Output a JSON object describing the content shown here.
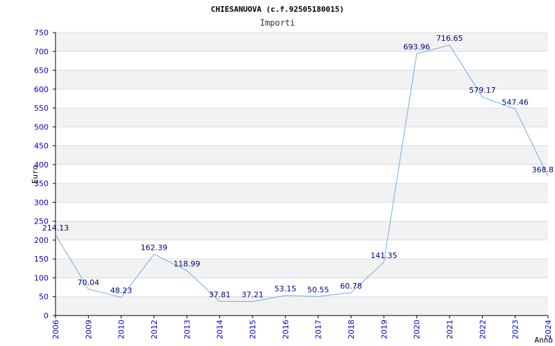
{
  "chart_data": {
    "type": "line",
    "title": "CHIESANUOVA (c.f.92505180015)",
    "subtitle": "Importi",
    "xlabel": "Anno",
    "ylabel": "Euro",
    "ylim": [
      0,
      750
    ],
    "ytick_step": 50,
    "categories": [
      "2006",
      "2009",
      "2010",
      "2012",
      "2013",
      "2014",
      "2015",
      "2016",
      "2017",
      "2018",
      "2019",
      "2020",
      "2021",
      "2022",
      "2023",
      "2024"
    ],
    "values": [
      214.13,
      70.04,
      48.23,
      162.39,
      118.99,
      37.81,
      37.21,
      53.15,
      50.55,
      60.78,
      141.35,
      693.96,
      716.65,
      579.17,
      547.46,
      368.8
    ],
    "labels": [
      "214.13",
      "70.04",
      "48.23",
      "162.39",
      "118.99",
      "37.81",
      "37.21",
      "53.15",
      "50.55",
      "60.78",
      "141.35",
      "693.96",
      "716.65",
      "579.17",
      "547.46",
      "368.8"
    ],
    "grid": true,
    "legend": "none"
  },
  "colors": {
    "line": "#6aaee8",
    "axis_text": "#0000cc",
    "label_text": "#000080",
    "band": "#f2f2f2",
    "grid": "#dcdcdc",
    "title_text": "#000000",
    "subtitle_text": "#333333"
  }
}
